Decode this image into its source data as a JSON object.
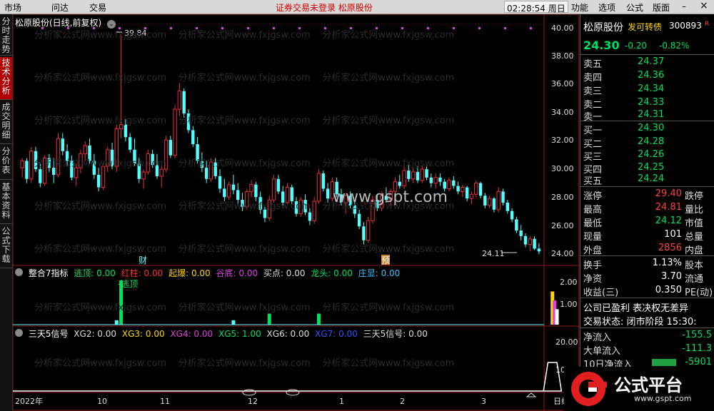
{
  "topbar": {
    "menu": [
      "市场",
      "问达",
      "交易"
    ],
    "notice": "证券交易未登录  松原股份",
    "clock": "02:28:54 周日",
    "win_menu": [
      "功能",
      "选项",
      "公式",
      "版面"
    ],
    "min_icon": "–",
    "close_icon": "×"
  },
  "left_tabs": [
    {
      "label": "分时走势",
      "active": false
    },
    {
      "label": "技术分析",
      "active": true
    },
    {
      "label": "成交明细",
      "active": false
    },
    {
      "label": "分价表",
      "active": false
    },
    {
      "label": "基本资料",
      "active": false
    },
    {
      "label": "公式下载",
      "active": false
    }
  ],
  "main_pane": {
    "title": "松原股份(日线,前复权)",
    "high_label": "39.84",
    "low_label": "24.11",
    "y_ticks": [
      "40.00",
      "38.00",
      "36.00",
      "34.00",
      "32.00",
      "30.00",
      "28.00",
      "26.00",
      "24.00"
    ],
    "markers": [
      "财",
      "预"
    ],
    "watermark_url": "www.gspt.com"
  },
  "pane2": {
    "name": "整合7指标",
    "items": [
      {
        "label": "逃顶: 0.00",
        "color": "#00e060"
      },
      {
        "label": "红柱: 0.00",
        "color": "#ff3030"
      },
      {
        "label": "起爆: 0.00",
        "color": "#ffd400"
      },
      {
        "label": "谷底: 0.00",
        "color": "#e040e0"
      },
      {
        "label": "买点: 0.00",
        "color": "#dddddd"
      },
      {
        "label": "龙头: 0.00",
        "color": "#00e060"
      },
      {
        "label": "庄显: 0.00",
        "color": "#40c0ff"
      }
    ],
    "bar_label": "-逃顶",
    "y_ticks": [
      "2.00",
      "1.00"
    ]
  },
  "pane3": {
    "name": "三天5信号",
    "items": [
      {
        "label": "XG2: 0.00",
        "color": "#dddddd"
      },
      {
        "label": "XG3: 0.00",
        "color": "#ffd400"
      },
      {
        "label": "XG4: 0.00",
        "color": "#e040e0"
      },
      {
        "label": "XG5: 1.00",
        "color": "#00e060"
      },
      {
        "label": "XG6: 0.00",
        "color": "#dddddd"
      },
      {
        "label": "XG7: 0.00",
        "color": "#3050ff"
      },
      {
        "label": "三天5信号: 0.00",
        "color": "#dddddd"
      }
    ],
    "y_ticks": [
      "20.00",
      "10.00"
    ]
  },
  "x_axis": {
    "labels": [
      "2022年",
      "10",
      "11",
      "12",
      "1",
      "2",
      "3"
    ],
    "period": "日线"
  },
  "quote": {
    "name": "松原股份",
    "conv": "发可转债",
    "code": "300893",
    "r_flag": "R",
    "price": "24.30",
    "change": "-0.20",
    "pct": "-0.82%",
    "asks": [
      {
        "label": "卖五",
        "price": "24.37"
      },
      {
        "label": "卖四",
        "price": "24.36"
      },
      {
        "label": "卖三",
        "price": "24.34"
      },
      {
        "label": "卖二",
        "price": "24.33"
      },
      {
        "label": "卖一",
        "price": "24.31"
      }
    ],
    "bids": [
      {
        "label": "买一",
        "price": "24.30"
      },
      {
        "label": "买二",
        "price": "24.28"
      },
      {
        "label": "买三",
        "price": "24.26"
      },
      {
        "label": "买四",
        "price": "24.25"
      },
      {
        "label": "买五",
        "price": "24.24"
      }
    ],
    "stats": [
      {
        "label": "涨停",
        "value": "29.40",
        "color": "#ff4040",
        "label2": "跌停"
      },
      {
        "label": "最高",
        "value": "24.81",
        "color": "#ff4040",
        "label2": "量比"
      },
      {
        "label": "最低",
        "value": "24.12",
        "color": "#00e060",
        "label2": "市值"
      },
      {
        "label": "现量",
        "value": "101",
        "color": "#ffffff",
        "label2": "总量"
      },
      {
        "label": "外盘",
        "value": "2856",
        "color": "#ff4040",
        "label2": "内盘"
      }
    ],
    "stats2": [
      {
        "label": "换手",
        "value": "1.13%",
        "label2": "股本"
      },
      {
        "label": "净资",
        "value": "3.70",
        "label2": "流通"
      },
      {
        "label": "收益(三)",
        "value": "0.350",
        "label2": "PE(动)"
      }
    ],
    "note": "公司已盈利 表决权无差异",
    "trade_status": "交易状态: 闭市阶段 15:30:",
    "flows": [
      {
        "label": "净流入",
        "value": "-155.5"
      },
      {
        "label": "大单流入",
        "value": "-111.3"
      },
      {
        "label": "10日净流入",
        "value": "-5901"
      }
    ]
  },
  "logo": {
    "text": "公式平台",
    "url": "www.gspt.com"
  },
  "colors": {
    "up": "#e8303a",
    "down": "#54ffff",
    "grid": "#8b1c1c"
  },
  "chart_data": {
    "type": "candlestick",
    "ylim": [
      23.5,
      40.6
    ],
    "candles": [
      [
        30.3,
        31.0,
        29.6,
        30.8
      ],
      [
        30.8,
        31.0,
        29.2,
        29.5
      ],
      [
        29.5,
        31.8,
        29.2,
        31.5
      ],
      [
        31.5,
        31.8,
        30.0,
        30.2
      ],
      [
        30.2,
        30.6,
        28.9,
        29.2
      ],
      [
        29.2,
        31.2,
        29.0,
        31.0
      ],
      [
        31.0,
        31.3,
        30.0,
        30.3
      ],
      [
        30.3,
        31.0,
        29.2,
        29.8
      ],
      [
        29.8,
        32.8,
        29.6,
        32.4
      ],
      [
        32.4,
        32.8,
        31.2,
        31.5
      ],
      [
        31.5,
        32.0,
        30.4,
        30.8
      ],
      [
        30.8,
        31.2,
        29.4,
        29.6
      ],
      [
        29.6,
        30.6,
        29.0,
        30.3
      ],
      [
        30.3,
        31.6,
        29.9,
        31.3
      ],
      [
        31.3,
        32.2,
        30.8,
        31.9
      ],
      [
        31.9,
        32.4,
        30.6,
        30.8
      ],
      [
        30.8,
        31.3,
        29.5,
        29.8
      ],
      [
        29.8,
        30.3,
        28.6,
        28.9
      ],
      [
        28.9,
        30.6,
        28.7,
        30.4
      ],
      [
        30.4,
        31.8,
        30.0,
        31.6
      ],
      [
        31.6,
        32.1,
        30.2,
        30.4
      ],
      [
        30.4,
        33.4,
        30.0,
        33.1
      ],
      [
        33.1,
        39.8,
        32.4,
        33.4
      ],
      [
        33.4,
        33.8,
        32.2,
        32.5
      ],
      [
        32.5,
        32.8,
        31.4,
        31.6
      ],
      [
        31.6,
        32.4,
        30.4,
        30.6
      ],
      [
        30.6,
        31.0,
        29.2,
        29.5
      ],
      [
        29.5,
        30.2,
        28.8,
        30.0
      ],
      [
        30.0,
        31.6,
        29.8,
        31.3
      ],
      [
        31.3,
        31.6,
        30.3,
        30.5
      ],
      [
        30.5,
        31.3,
        29.5,
        29.7
      ],
      [
        29.7,
        30.5,
        28.9,
        30.2
      ],
      [
        30.2,
        32.6,
        30.0,
        32.3
      ],
      [
        32.3,
        32.6,
        31.0,
        31.2
      ],
      [
        31.2,
        34.8,
        31.0,
        34.5
      ],
      [
        34.5,
        36.4,
        34.0,
        35.8
      ],
      [
        35.8,
        36.0,
        33.9,
        34.2
      ],
      [
        34.2,
        34.5,
        32.8,
        33.0
      ],
      [
        33.0,
        33.3,
        31.8,
        32.0
      ],
      [
        32.0,
        32.5,
        30.6,
        30.8
      ],
      [
        30.8,
        31.4,
        30.0,
        30.3
      ],
      [
        30.3,
        30.8,
        29.2,
        29.5
      ],
      [
        29.5,
        31.0,
        29.3,
        30.7
      ],
      [
        30.7,
        31.0,
        29.5,
        29.7
      ],
      [
        29.7,
        30.2,
        28.5,
        28.8
      ],
      [
        28.8,
        29.5,
        27.9,
        28.2
      ],
      [
        28.2,
        29.3,
        28.0,
        29.1
      ],
      [
        29.1,
        29.8,
        28.4,
        28.7
      ],
      [
        28.7,
        29.2,
        27.7,
        28.0
      ],
      [
        28.0,
        28.5,
        27.2,
        27.5
      ],
      [
        27.5,
        28.8,
        27.3,
        28.6
      ],
      [
        28.6,
        29.4,
        28.2,
        29.1
      ],
      [
        29.1,
        29.3,
        27.9,
        28.2
      ],
      [
        28.2,
        28.6,
        27.0,
        27.3
      ],
      [
        27.3,
        27.6,
        26.4,
        26.7
      ],
      [
        26.7,
        28.3,
        26.5,
        28.0
      ],
      [
        28.0,
        29.8,
        27.8,
        29.5
      ],
      [
        29.5,
        29.8,
        28.4,
        28.6
      ],
      [
        28.6,
        29.0,
        27.6,
        27.8
      ],
      [
        27.8,
        29.2,
        27.6,
        28.9
      ],
      [
        28.9,
        29.1,
        27.7,
        27.9
      ],
      [
        27.9,
        28.2,
        26.8,
        27.0
      ],
      [
        27.0,
        28.2,
        26.8,
        28.0
      ],
      [
        28.0,
        28.4,
        26.9,
        27.1
      ],
      [
        27.1,
        27.4,
        26.2,
        26.5
      ],
      [
        26.5,
        28.2,
        26.3,
        27.9
      ],
      [
        27.9,
        30.2,
        27.7,
        29.9
      ],
      [
        29.9,
        30.1,
        28.6,
        28.8
      ],
      [
        28.8,
        29.2,
        27.8,
        28.1
      ],
      [
        28.1,
        29.6,
        27.9,
        29.3
      ],
      [
        29.3,
        29.6,
        28.2,
        28.4
      ],
      [
        28.4,
        28.8,
        27.6,
        27.8
      ],
      [
        27.8,
        28.5,
        27.0,
        28.3
      ],
      [
        28.3,
        28.6,
        27.4,
        27.6
      ],
      [
        27.6,
        27.9,
        26.7,
        27.0
      ],
      [
        27.0,
        27.3,
        25.9,
        26.1
      ],
      [
        26.1,
        26.4,
        24.8,
        25.1
      ],
      [
        25.1,
        26.8,
        24.9,
        26.5
      ],
      [
        26.5,
        28.3,
        26.3,
        28.0
      ],
      [
        28.0,
        28.3,
        27.2,
        27.4
      ],
      [
        27.4,
        28.6,
        27.2,
        28.3
      ],
      [
        28.3,
        28.9,
        27.8,
        28.0
      ],
      [
        28.0,
        28.8,
        27.6,
        28.6
      ],
      [
        28.6,
        29.6,
        28.2,
        29.3
      ],
      [
        29.3,
        29.8,
        28.8,
        29.0
      ],
      [
        29.0,
        30.4,
        28.8,
        30.1
      ],
      [
        30.1,
        30.5,
        29.3,
        29.5
      ],
      [
        29.5,
        30.3,
        29.2,
        30.0
      ],
      [
        30.0,
        30.4,
        29.2,
        29.4
      ],
      [
        29.4,
        30.5,
        29.2,
        30.2
      ],
      [
        30.2,
        30.4,
        29.4,
        29.6
      ],
      [
        29.6,
        29.9,
        28.9,
        29.2
      ],
      [
        29.2,
        29.9,
        28.8,
        29.6
      ],
      [
        29.6,
        29.9,
        29.0,
        29.3
      ],
      [
        29.3,
        29.5,
        28.6,
        28.8
      ],
      [
        28.8,
        29.6,
        28.6,
        29.4
      ],
      [
        29.4,
        29.7,
        28.8,
        29.0
      ],
      [
        29.0,
        29.3,
        28.4,
        28.6
      ],
      [
        28.6,
        29.1,
        28.2,
        28.9
      ],
      [
        28.9,
        29.0,
        27.9,
        28.1
      ],
      [
        28.1,
        28.6,
        27.7,
        28.4
      ],
      [
        28.4,
        29.4,
        28.2,
        29.2
      ],
      [
        29.2,
        29.3,
        28.1,
        28.3
      ],
      [
        28.3,
        28.5,
        27.4,
        27.6
      ],
      [
        27.6,
        28.3,
        27.4,
        28.1
      ],
      [
        28.1,
        28.2,
        27.1,
        27.3
      ],
      [
        27.3,
        28.9,
        27.1,
        28.6
      ],
      [
        28.6,
        28.8,
        27.6,
        27.8
      ],
      [
        27.8,
        28.0,
        27.0,
        27.2
      ],
      [
        27.2,
        27.4,
        26.4,
        26.6
      ],
      [
        26.6,
        26.8,
        25.6,
        25.8
      ],
      [
        25.8,
        26.2,
        25.1,
        25.4
      ],
      [
        25.4,
        25.6,
        24.6,
        24.8
      ],
      [
        24.8,
        25.4,
        24.3,
        25.2
      ],
      [
        25.2,
        25.4,
        24.4,
        24.5
      ],
      [
        24.5,
        24.9,
        24.1,
        24.3
      ]
    ],
    "pane2_bars": [
      {
        "i": 21,
        "v": 0.2,
        "color": "#54ffff"
      },
      {
        "i": 22,
        "v": 2.0,
        "color": "#00e060"
      },
      {
        "i": 47,
        "v": 0.2,
        "color": "#54ffff"
      },
      {
        "i": 55,
        "v": 0.5,
        "color": "#00e060"
      },
      {
        "i": 66,
        "v": 0.5,
        "color": "#00e060"
      },
      {
        "i": 118,
        "v": 1.5,
        "color": "#ffd400"
      },
      {
        "i": 118,
        "v": 1.1,
        "color": "#e040e0"
      },
      {
        "i": 119,
        "v": 0.7,
        "color": "#ffffff"
      }
    ],
    "pane3_spike": {
      "start": 116,
      "peak_from": 117,
      "peak_to": 119,
      "end": 120,
      "v": 20
    }
  }
}
